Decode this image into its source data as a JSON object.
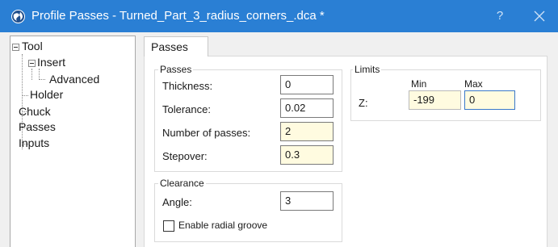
{
  "window": {
    "title": "Profile Passes - Turned_Part_3_radius_corners_.dca *",
    "help_label": "?",
    "app_icon": "globe-icon",
    "close_icon": "close-icon"
  },
  "tree": {
    "items": [
      {
        "label": "Tool"
      },
      {
        "label": "Insert"
      },
      {
        "label": "Advanced"
      },
      {
        "label": "Holder"
      },
      {
        "label": "Chuck"
      },
      {
        "label": "Passes"
      },
      {
        "label": "Inputs"
      }
    ]
  },
  "tab": {
    "label": "Passes"
  },
  "passes": {
    "title": "Passes",
    "thickness": {
      "label": "Thickness:",
      "value": "0"
    },
    "tolerance": {
      "label": "Tolerance:",
      "value": "0.02"
    },
    "num_passes": {
      "label": "Number of passes:",
      "value": "2"
    },
    "stepover": {
      "label": "Stepover:",
      "value": "0.3"
    }
  },
  "limits": {
    "title": "Limits",
    "min_header": "Min",
    "max_header": "Max",
    "z_label": "Z:",
    "z_min": "-199",
    "z_max": "0"
  },
  "clearance": {
    "title": "Clearance",
    "angle": {
      "label": "Angle:",
      "value": "3"
    },
    "radial_groove": {
      "label": "Enable radial groove",
      "checked": false
    }
  }
}
